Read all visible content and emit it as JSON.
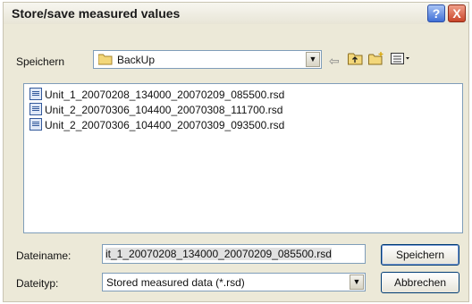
{
  "window": {
    "title": "Store/save measured values",
    "help": "?",
    "close": "X"
  },
  "save_in": {
    "label": "Speichern",
    "folder": "BackUp"
  },
  "toolbar": {
    "back_icon": "back-arrow-icon",
    "up_icon": "up-folder-icon",
    "new_folder_icon": "new-folder-icon",
    "view_icon": "view-menu-icon"
  },
  "files": [
    "Unit_1_20070208_134000_20070209_085500.rsd",
    "Unit_2_20070306_104400_20070308_111700.rsd",
    "Unit_2_20070306_104400_20070309_093500.rsd"
  ],
  "filename": {
    "label": "Dateiname:",
    "value": "it_1_20070208_134000_20070209_085500.rsd"
  },
  "filetype": {
    "label": "Dateityp:",
    "value": "Stored measured data (*.rsd)"
  },
  "buttons": {
    "save": "Speichern",
    "cancel": "Abbrechen"
  }
}
